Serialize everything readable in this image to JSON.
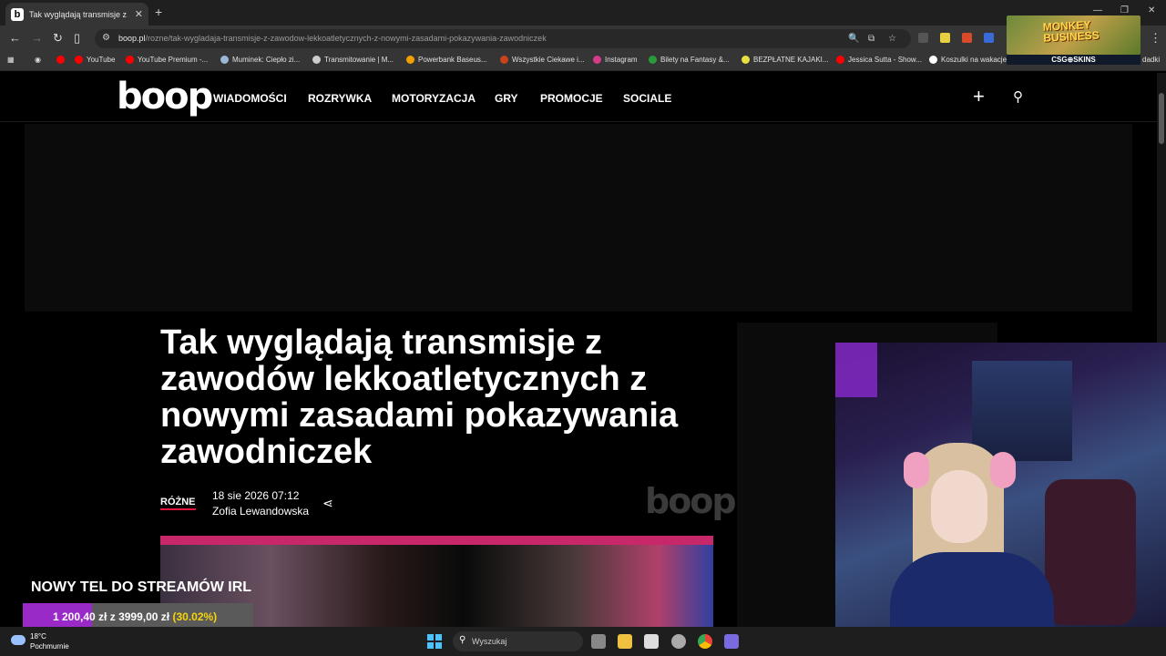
{
  "browser": {
    "tab_title": "Tak wyglądają transmisje z zaw",
    "tab_favicon": "b",
    "url_host": "boop.pl",
    "url_path": "/rozne/tak-wygladaja-transmisje-z-zawodow-lekkoatletycznych-z-nowymi-zasadami-pokazywania-zawodniczek",
    "bookmarks": [
      {
        "label": "YouTube",
        "icon_color": "#ff0000"
      },
      {
        "label": "YouTube Premium -...",
        "icon_color": "#ff0000"
      },
      {
        "label": "Muminek: Ciepło zi...",
        "icon_color": "#9ab8d8"
      },
      {
        "label": "Transmitowanie | M...",
        "icon_color": "#cccccc"
      },
      {
        "label": "Powerbank Baseus...",
        "icon_color": "#f2a000"
      },
      {
        "label": "Wszystkie Ciekawe i...",
        "icon_color": "#c8421a"
      },
      {
        "label": "Instagram",
        "icon_color": "#d63a8a"
      },
      {
        "label": "Bilety na Fantasy &...",
        "icon_color": "#2a9a3a"
      },
      {
        "label": "BEZPŁATNE KAJAKI...",
        "icon_color": "#e8e040"
      },
      {
        "label": "Jessica Sutta - Show...",
        "icon_color": "#ff0000"
      },
      {
        "label": "Koszulki na wakacje",
        "icon_color": "#ffffff"
      }
    ],
    "bookmarks_overflow": "dadki"
  },
  "overlay": {
    "sponsor_game": "MONKEY BUSINESS",
    "sponsor_brand": "CSG⊕SKINS",
    "goal_title": "NOWY TEL DO STREAMÓW IRL",
    "goal_current": "1 200,40 zł",
    "goal_sep": "z",
    "goal_target": "3999,00 zł",
    "goal_percent": "(30.02%)",
    "goal_fraction": 0.3002
  },
  "site": {
    "logo": "boop",
    "nav": [
      "WIADOMOŚCI",
      "ROZRYWKA",
      "MOTORYZACJA",
      "GRY",
      "PROMOCJE",
      "SOCIALE"
    ]
  },
  "article": {
    "headline": "Tak wyglądają transmisje z zawodów lekkoatletycznych z nowymi zasadami pokazywania zawodniczek",
    "category": "RÓŻNE",
    "date": "18 sie 2026 07:12",
    "author": "Zofia Lewandowska",
    "watermark": "boop"
  },
  "taskbar": {
    "temperature": "18°C",
    "condition": "Pochmurnie",
    "search_placeholder": "Wyszukaj"
  }
}
